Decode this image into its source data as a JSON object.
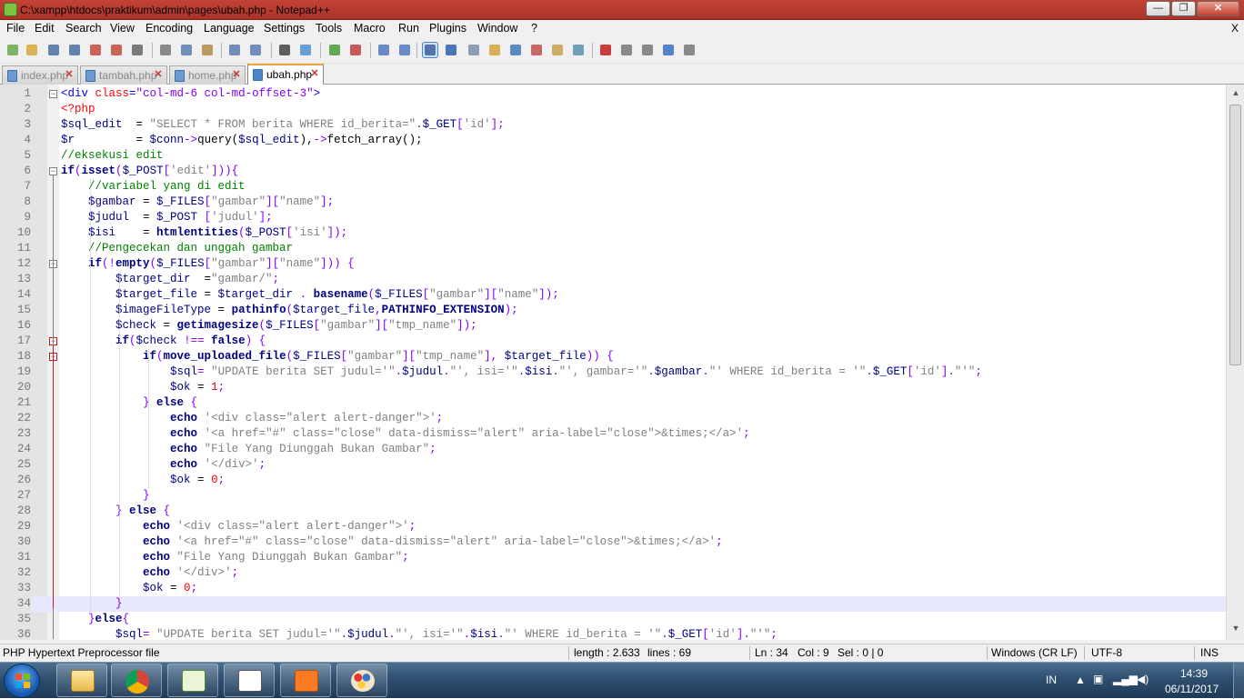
{
  "window": {
    "title": "C:\\xampp\\htdocs\\praktikum\\admin\\pages\\ubah.php - Notepad++",
    "minimize_glyph": "—",
    "restore_glyph": "❐",
    "close_glyph": "✕"
  },
  "menu": {
    "items": [
      "File",
      "Edit",
      "Search",
      "View",
      "Encoding",
      "Language",
      "Settings",
      "Tools",
      "Macro",
      "Run",
      "Plugins",
      "Window",
      "?"
    ],
    "close_x": "X"
  },
  "toolbar": {
    "icons": [
      "new-file-icon",
      "open-file-icon",
      "save-icon",
      "save-all-icon",
      "close-icon",
      "close-all-icon",
      "print-icon",
      "cut-icon",
      "copy-icon",
      "paste-icon",
      "undo-icon",
      "redo-icon",
      "find-icon",
      "replace-icon",
      "zoom-in-icon",
      "zoom-out-icon",
      "sync-vertical-icon",
      "sync-horizontal-icon",
      "word-wrap-icon",
      "show-all-chars-icon",
      "indent-guide-icon",
      "user-language-icon",
      "doc-map-icon",
      "function-list-icon",
      "folder-workspace-icon",
      "monitoring-icon",
      "record-macro-icon",
      "stop-record-icon",
      "play-macro-icon",
      "run-macro-multiple-icon",
      "save-macro-icon"
    ]
  },
  "tabs": [
    {
      "label": "index.php",
      "active": false
    },
    {
      "label": "tambah.php",
      "active": false
    },
    {
      "label": "home.php",
      "active": false
    },
    {
      "label": "ubah.php",
      "active": true
    }
  ],
  "code": {
    "current_line": 34,
    "lines": [
      [
        [
          "tag",
          "<div "
        ],
        [
          "atn",
          "class"
        ],
        [
          "tag",
          "="
        ],
        [
          "atv",
          "\"col-md-6 col-md-offset-3\""
        ],
        [
          "tag",
          ">"
        ]
      ],
      [
        [
          "ph",
          "<?php"
        ]
      ],
      [
        [
          "vr",
          "$sql_edit"
        ],
        [
          "",
          "  = "
        ],
        [
          "st",
          "\"SELECT * FROM berita WHERE id_berita=\""
        ],
        [
          "op",
          "."
        ],
        [
          "vr",
          "$_GET"
        ],
        [
          "op",
          "["
        ],
        [
          "st",
          "'id'"
        ],
        [
          "op",
          "];"
        ]
      ],
      [
        [
          "vr",
          "$r"
        ],
        [
          "",
          "         = "
        ],
        [
          "vr",
          "$conn"
        ],
        [
          "op",
          "->"
        ],
        [
          "",
          "query("
        ],
        [
          "vr",
          "$sql_edit"
        ],
        [
          "",
          "),"
        ],
        [
          "op",
          "->"
        ],
        [
          "",
          "fetch_array();"
        ]
      ],
      [
        [
          "cm",
          "//eksekusi edit"
        ]
      ],
      [
        [
          "kw",
          "if"
        ],
        [
          "op",
          "("
        ],
        [
          "fn",
          "isset"
        ],
        [
          "op",
          "("
        ],
        [
          "vr",
          "$_POST"
        ],
        [
          "op",
          "["
        ],
        [
          "st",
          "'edit'"
        ],
        [
          "op",
          "])){"
        ]
      ],
      [
        [
          "",
          "    "
        ],
        [
          "cm",
          "//variabel yang di edit"
        ]
      ],
      [
        [
          "",
          "    "
        ],
        [
          "vr",
          "$gambar"
        ],
        [
          "",
          " = "
        ],
        [
          "vr",
          "$_FILES"
        ],
        [
          "op",
          "["
        ],
        [
          "st",
          "\"gambar\""
        ],
        [
          "op",
          "]["
        ],
        [
          "st",
          "\"name\""
        ],
        [
          "op",
          "];"
        ]
      ],
      [
        [
          "",
          "    "
        ],
        [
          "vr",
          "$judul"
        ],
        [
          "",
          "  = "
        ],
        [
          "vr",
          "$_POST"
        ],
        [
          "",
          " "
        ],
        [
          "op",
          "["
        ],
        [
          "st",
          "'judul'"
        ],
        [
          "op",
          "];"
        ]
      ],
      [
        [
          "",
          "    "
        ],
        [
          "vr",
          "$isi"
        ],
        [
          "",
          "    = "
        ],
        [
          "fn",
          "htmlentities"
        ],
        [
          "op",
          "("
        ],
        [
          "vr",
          "$_POST"
        ],
        [
          "op",
          "["
        ],
        [
          "st",
          "'isi'"
        ],
        [
          "op",
          "]);"
        ]
      ],
      [
        [
          "",
          "    "
        ],
        [
          "cm",
          "//Pengecekan dan unggah gambar"
        ]
      ],
      [
        [
          "",
          "    "
        ],
        [
          "kw",
          "if"
        ],
        [
          "op",
          "(!"
        ],
        [
          "fn",
          "empty"
        ],
        [
          "op",
          "("
        ],
        [
          "vr",
          "$_FILES"
        ],
        [
          "op",
          "["
        ],
        [
          "st",
          "\"gambar\""
        ],
        [
          "op",
          "]["
        ],
        [
          "st",
          "\"name\""
        ],
        [
          "op",
          "])) {"
        ]
      ],
      [
        [
          "",
          "        "
        ],
        [
          "vr",
          "$target_dir"
        ],
        [
          "",
          "  ="
        ],
        [
          "st",
          "\"gambar/\""
        ],
        [
          "op",
          ";"
        ]
      ],
      [
        [
          "",
          "        "
        ],
        [
          "vr",
          "$target_file"
        ],
        [
          "",
          " = "
        ],
        [
          "vr",
          "$target_dir"
        ],
        [
          "",
          " "
        ],
        [
          "op",
          "."
        ],
        [
          "",
          " "
        ],
        [
          "fn",
          "basename"
        ],
        [
          "op",
          "("
        ],
        [
          "vr",
          "$_FILES"
        ],
        [
          "op",
          "["
        ],
        [
          "st",
          "\"gambar\""
        ],
        [
          "op",
          "]["
        ],
        [
          "st",
          "\"name\""
        ],
        [
          "op",
          "]);"
        ]
      ],
      [
        [
          "",
          "        "
        ],
        [
          "vr",
          "$imageFileType"
        ],
        [
          "",
          " = "
        ],
        [
          "fn",
          "pathinfo"
        ],
        [
          "op",
          "("
        ],
        [
          "vr",
          "$target_file"
        ],
        [
          "op",
          ","
        ],
        [
          "fn",
          "PATHINFO_EXTENSION"
        ],
        [
          "op",
          ");"
        ]
      ],
      [
        [
          "",
          "        "
        ],
        [
          "vr",
          "$check"
        ],
        [
          "",
          " = "
        ],
        [
          "fn",
          "getimagesize"
        ],
        [
          "op",
          "("
        ],
        [
          "vr",
          "$_FILES"
        ],
        [
          "op",
          "["
        ],
        [
          "st",
          "\"gambar\""
        ],
        [
          "op",
          "]["
        ],
        [
          "st",
          "\"tmp_name\""
        ],
        [
          "op",
          "]);"
        ]
      ],
      [
        [
          "",
          "        "
        ],
        [
          "kw",
          "if"
        ],
        [
          "op",
          "("
        ],
        [
          "vr",
          "$check"
        ],
        [
          "",
          " "
        ],
        [
          "op",
          "!=="
        ],
        [
          "",
          " "
        ],
        [
          "kw",
          "false"
        ],
        [
          "op",
          ") {"
        ]
      ],
      [
        [
          "",
          "            "
        ],
        [
          "kw",
          "if"
        ],
        [
          "op",
          "("
        ],
        [
          "fn",
          "move_uploaded_file"
        ],
        [
          "op",
          "("
        ],
        [
          "vr",
          "$_FILES"
        ],
        [
          "op",
          "["
        ],
        [
          "st",
          "\"gambar\""
        ],
        [
          "op",
          "]["
        ],
        [
          "st",
          "\"tmp_name\""
        ],
        [
          "op",
          "],"
        ],
        [
          "",
          " "
        ],
        [
          "vr",
          "$target_file"
        ],
        [
          "op",
          ")) {"
        ]
      ],
      [
        [
          "",
          "                "
        ],
        [
          "vr",
          "$sql"
        ],
        [
          "op",
          "="
        ],
        [
          "",
          " "
        ],
        [
          "st",
          "\"UPDATE berita SET judul='\""
        ],
        [
          "op",
          "."
        ],
        [
          "vr",
          "$judul"
        ],
        [
          "op",
          "."
        ],
        [
          "st",
          "\"', isi='\""
        ],
        [
          "op",
          "."
        ],
        [
          "vr",
          "$isi"
        ],
        [
          "op",
          "."
        ],
        [
          "st",
          "\"', gambar='\""
        ],
        [
          "op",
          "."
        ],
        [
          "vr",
          "$gambar"
        ],
        [
          "op",
          "."
        ],
        [
          "st",
          "\"' WHERE id_berita = '\""
        ],
        [
          "op",
          "."
        ],
        [
          "vr",
          "$_GET"
        ],
        [
          "op",
          "["
        ],
        [
          "st",
          "'id'"
        ],
        [
          "op",
          "]."
        ],
        [
          "st",
          "\"'\""
        ],
        [
          "op",
          ";"
        ]
      ],
      [
        [
          "",
          "                "
        ],
        [
          "vr",
          "$ok"
        ],
        [
          "",
          " = "
        ],
        [
          "num2",
          "1"
        ],
        [
          "op",
          ";"
        ]
      ],
      [
        [
          "",
          "            "
        ],
        [
          "op",
          "} "
        ],
        [
          "kw",
          "else"
        ],
        [
          "op",
          " {"
        ]
      ],
      [
        [
          "",
          "                "
        ],
        [
          "kw",
          "echo"
        ],
        [
          "",
          " "
        ],
        [
          "st",
          "'<div class=\"alert alert-danger\">'"
        ],
        [
          "op",
          ";"
        ]
      ],
      [
        [
          "",
          "                "
        ],
        [
          "kw",
          "echo"
        ],
        [
          "",
          " "
        ],
        [
          "st",
          "'<a href=\"#\" class=\"close\" data-dismiss=\"alert\" aria-label=\"close\">&times;</a>'"
        ],
        [
          "op",
          ";"
        ]
      ],
      [
        [
          "",
          "                "
        ],
        [
          "kw",
          "echo"
        ],
        [
          "",
          " "
        ],
        [
          "st",
          "\"File Yang Diunggah Bukan Gambar\""
        ],
        [
          "op",
          ";"
        ]
      ],
      [
        [
          "",
          "                "
        ],
        [
          "kw",
          "echo"
        ],
        [
          "",
          " "
        ],
        [
          "st",
          "'</div>'"
        ],
        [
          "op",
          ";"
        ]
      ],
      [
        [
          "",
          "                "
        ],
        [
          "vr",
          "$ok"
        ],
        [
          "",
          " = "
        ],
        [
          "num2",
          "0"
        ],
        [
          "op",
          ";"
        ]
      ],
      [
        [
          "",
          "            "
        ],
        [
          "op",
          "}"
        ]
      ],
      [
        [
          "",
          "        "
        ],
        [
          "op",
          "} "
        ],
        [
          "kw",
          "else"
        ],
        [
          "op",
          " {"
        ]
      ],
      [
        [
          "",
          "            "
        ],
        [
          "kw",
          "echo"
        ],
        [
          "",
          " "
        ],
        [
          "st",
          "'<div class=\"alert alert-danger\">'"
        ],
        [
          "op",
          ";"
        ]
      ],
      [
        [
          "",
          "            "
        ],
        [
          "kw",
          "echo"
        ],
        [
          "",
          " "
        ],
        [
          "st",
          "'<a href=\"#\" class=\"close\" data-dismiss=\"alert\" aria-label=\"close\">&times;</a>'"
        ],
        [
          "op",
          ";"
        ]
      ],
      [
        [
          "",
          "            "
        ],
        [
          "kw",
          "echo"
        ],
        [
          "",
          " "
        ],
        [
          "st",
          "\"File Yang Diunggah Bukan Gambar\""
        ],
        [
          "op",
          ";"
        ]
      ],
      [
        [
          "",
          "            "
        ],
        [
          "kw",
          "echo"
        ],
        [
          "",
          " "
        ],
        [
          "st",
          "'</div>'"
        ],
        [
          "op",
          ";"
        ]
      ],
      [
        [
          "",
          "            "
        ],
        [
          "vr",
          "$ok"
        ],
        [
          "",
          " = "
        ],
        [
          "num2",
          "0"
        ],
        [
          "op",
          ";"
        ]
      ],
      [
        [
          "",
          "        "
        ],
        [
          "op",
          "}"
        ]
      ],
      [
        [
          "",
          "    "
        ],
        [
          "op",
          "}"
        ],
        [
          "kw",
          "else"
        ],
        [
          "op",
          "{"
        ]
      ],
      [
        [
          "",
          "        "
        ],
        [
          "vr",
          "$sql"
        ],
        [
          "op",
          "="
        ],
        [
          "",
          " "
        ],
        [
          "st",
          "\"UPDATE berita SET judul='\""
        ],
        [
          "op",
          "."
        ],
        [
          "vr",
          "$judul"
        ],
        [
          "op",
          "."
        ],
        [
          "st",
          "\"', isi='\""
        ],
        [
          "op",
          "."
        ],
        [
          "vr",
          "$isi"
        ],
        [
          "op",
          "."
        ],
        [
          "st",
          "\"' WHERE id_berita = '\""
        ],
        [
          "op",
          "."
        ],
        [
          "vr",
          "$_GET"
        ],
        [
          "op",
          "["
        ],
        [
          "st",
          "'id'"
        ],
        [
          "op",
          "]."
        ],
        [
          "st",
          "\"'\""
        ],
        [
          "op",
          ";"
        ]
      ]
    ]
  },
  "status": {
    "filetype": "PHP Hypertext Preprocessor file",
    "length": "length : 2.633",
    "lines": "lines : 69",
    "ln": "Ln : 34",
    "col": "Col : 9",
    "sel": "Sel : 0 | 0",
    "eol": "Windows (CR LF)",
    "encoding": "UTF-8",
    "mode": "INS"
  },
  "taskbar": {
    "apps": [
      "file-explorer-icon",
      "chrome-icon",
      "notepad-plus-plus-icon",
      "notepad-icon",
      "xampp-icon",
      "paint-icon"
    ],
    "language": "IN",
    "time": "14:39",
    "date": "06/11/2017"
  },
  "colors": {
    "keyword": "#000080",
    "string": "#808080",
    "comment": "#008000",
    "operator": "#8000ff",
    "php_tag": "#ff0000",
    "current_line": "#e8e8ff",
    "tab_accent": "#f2a23b"
  }
}
